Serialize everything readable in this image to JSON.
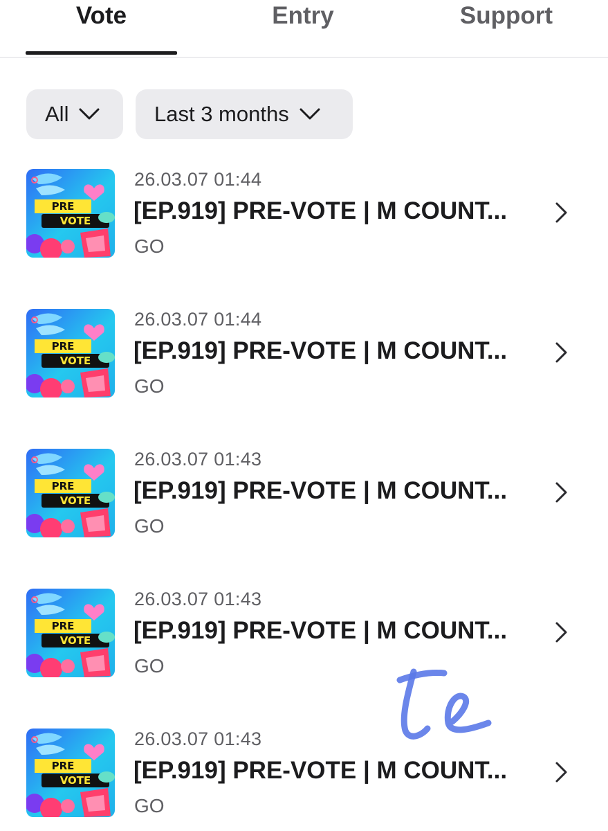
{
  "tabs": {
    "vote": "Vote",
    "entry": "Entry",
    "support": "Support"
  },
  "filters": {
    "category": "All",
    "period": "Last 3 months"
  },
  "thumbnail_text": {
    "line1": "PRE",
    "line2": "VOTE"
  },
  "items": [
    {
      "date": "26.03.07 01:44",
      "title": "[EP.919] PRE-VOTE | M COUNT...",
      "status": "GO"
    },
    {
      "date": "26.03.07 01:44",
      "title": "[EP.919] PRE-VOTE | M COUNT...",
      "status": "GO"
    },
    {
      "date": "26.03.07 01:43",
      "title": "[EP.919] PRE-VOTE | M COUNT...",
      "status": "GO"
    },
    {
      "date": "26.03.07 01:43",
      "title": "[EP.919] PRE-VOTE | M COUNT...",
      "status": "GO"
    },
    {
      "date": "26.03.07 01:43",
      "title": "[EP.919] PRE-VOTE | M COUNT...",
      "status": "GO"
    }
  ],
  "icons": {
    "filter_dropdown": "chevron-down-icon",
    "row_arrow": "chevron-right-icon"
  },
  "colors": {
    "active_tab": "#1c1c1e",
    "inactive_tab": "#5f5f63",
    "filter_bg": "#ebebee",
    "handwriting": "#5b79e8"
  }
}
